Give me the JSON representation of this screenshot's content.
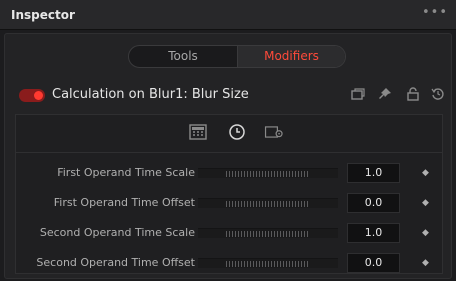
{
  "header": {
    "title": "Inspector",
    "more_glyph": "•••"
  },
  "segmented": {
    "tools_label": "Tools",
    "modifiers_label": "Modifiers",
    "active": "Modifiers",
    "accent_color": "#ff4a3a"
  },
  "tool": {
    "enabled": true,
    "title": "Calculation on Blur1: Blur Size",
    "icons": [
      "window-icon",
      "pin-icon",
      "lock-icon",
      "reset-icon"
    ]
  },
  "tabs": [
    {
      "icon": "calculator-icon",
      "active": false
    },
    {
      "icon": "clock-icon",
      "active": true
    },
    {
      "icon": "settings-panel-icon",
      "active": false
    }
  ],
  "parameters": [
    {
      "label": "First Operand Time Scale",
      "value": "1.0"
    },
    {
      "label": "First Operand Time Offset",
      "value": "0.0"
    },
    {
      "label": "Second Operand Time Scale",
      "value": "1.0"
    },
    {
      "label": "Second Operand Time Offset",
      "value": "0.0"
    }
  ],
  "keyframe_glyph": "◆"
}
